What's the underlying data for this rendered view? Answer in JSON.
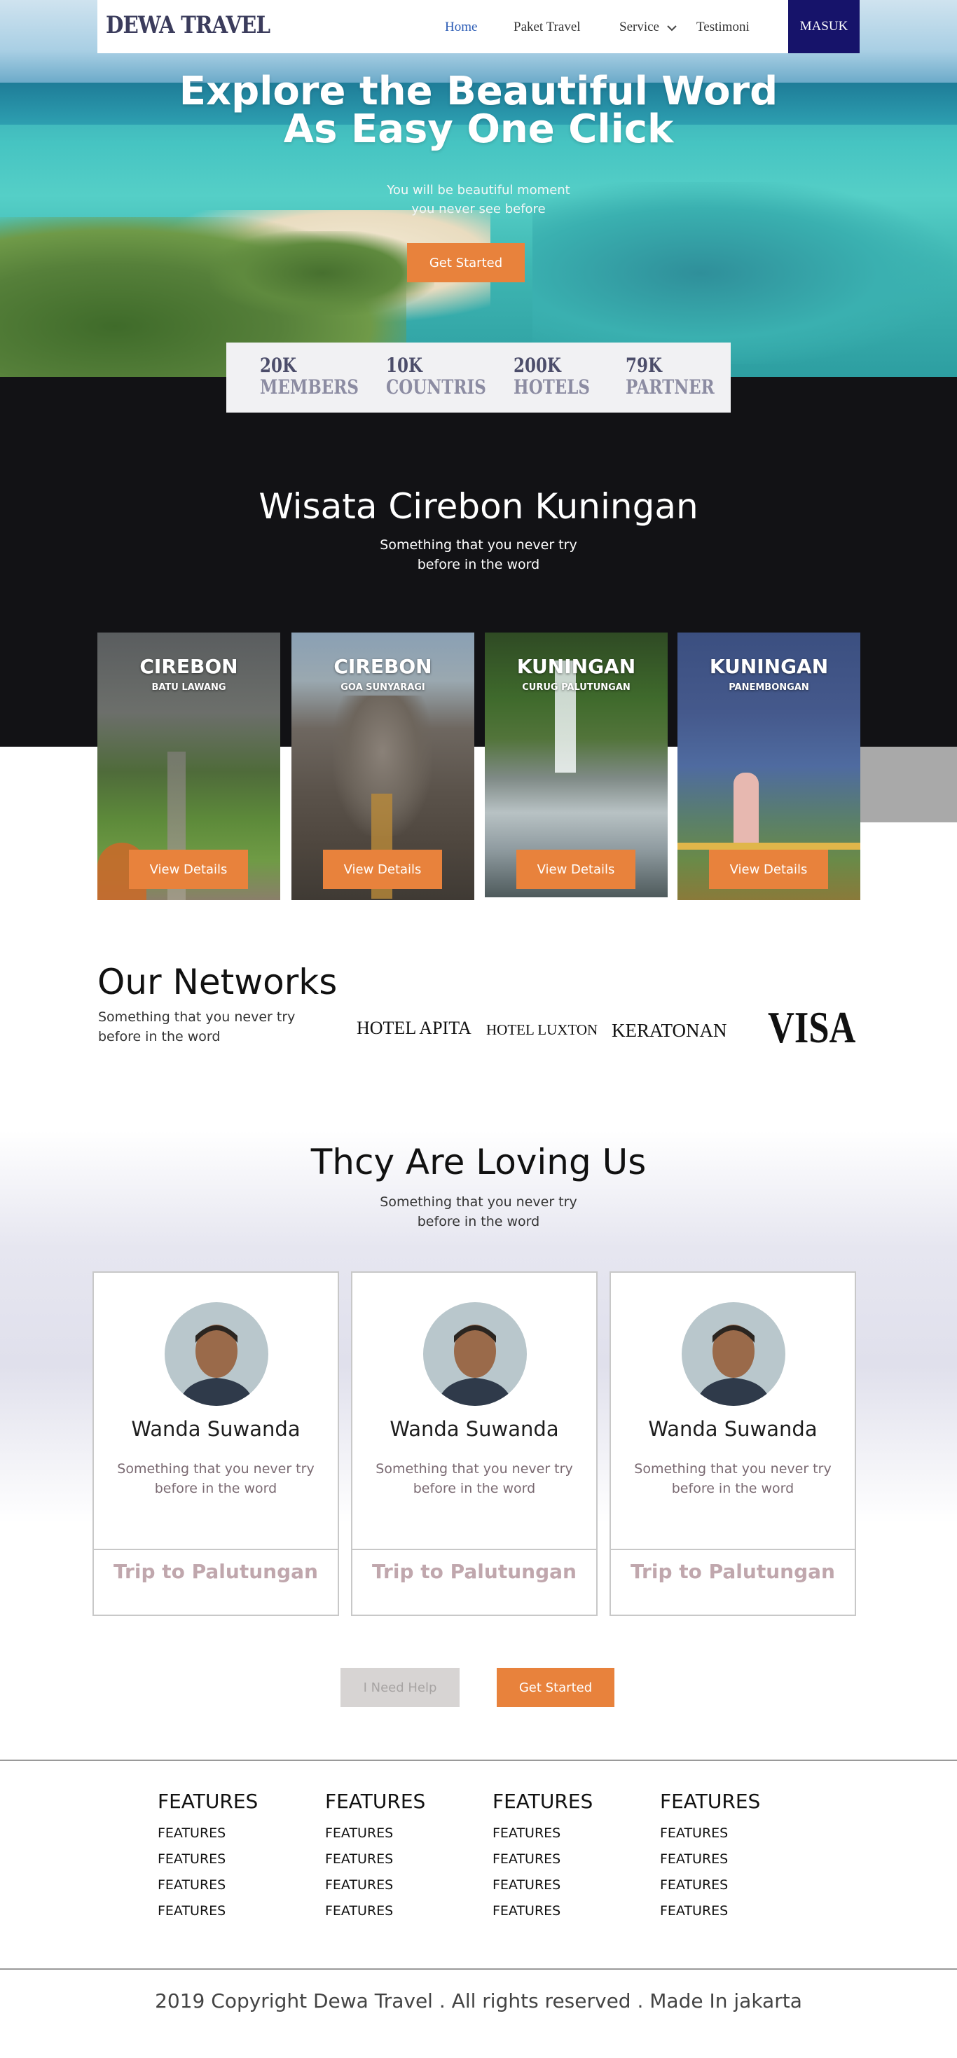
{
  "nav": {
    "logo": "DEWA TRAVEL",
    "links": [
      "Home",
      "Paket Travel",
      "Service",
      "Testimoni"
    ],
    "login": "MASUK"
  },
  "hero": {
    "title_line1": "Explore the Beautiful Word",
    "title_line2": "As Easy One Click",
    "sub_line1": "You will be beautiful moment",
    "sub_line2": "you never see before",
    "cta": "Get Started"
  },
  "stats": [
    {
      "value": "20K",
      "label": "MEMBERS"
    },
    {
      "value": "10K",
      "label": "COUNTRIS"
    },
    {
      "value": "200K",
      "label": "HOTELS"
    },
    {
      "value": "79K",
      "label": "PARTNER"
    }
  ],
  "destinations": {
    "title": "Wisata Cirebon Kuningan",
    "sub_line1": "Something that you never try",
    "sub_line2": "before in the word",
    "cards": [
      {
        "title": "CIREBON",
        "sub": "BATU LAWANG",
        "button": "View Details"
      },
      {
        "title": "CIREBON",
        "sub": "GOA SUNYARAGI",
        "button": "View Details"
      },
      {
        "title": "KUNINGAN",
        "sub": "CURUG PALUTUNGAN",
        "button": "View Details"
      },
      {
        "title": "KUNINGAN",
        "sub": "PANEMBONGAN",
        "button": "View Details"
      }
    ]
  },
  "networks": {
    "title": "Our Networks",
    "sub_line1": "Something that you never try",
    "sub_line2": "before in the word",
    "partners": [
      "HOTEL APITA",
      "HOTEL LUXTON",
      "KERATONAN",
      "VISA"
    ]
  },
  "testimonials": {
    "title": "Thcy Are Loving Us",
    "sub_line1": "Something that you never try",
    "sub_line2": "before in the word",
    "cards": [
      {
        "name": "Wanda Suwanda",
        "text_line1": "Something that you never try",
        "text_line2": "before in the word",
        "trip": "Trip to Palutungan"
      },
      {
        "name": "Wanda Suwanda",
        "text_line1": "Something that you never try",
        "text_line2": "before in the word",
        "trip": "Trip to Palutungan"
      },
      {
        "name": "Wanda Suwanda",
        "text_line1": "Something that you never try",
        "text_line2": "before in the word",
        "trip": "Trip to Palutungan"
      }
    ],
    "help_button": "I Need Help",
    "start_button": "Get Started"
  },
  "footer": {
    "columns": [
      {
        "heading": "FEATURES",
        "items": [
          "FEATURES",
          "FEATURES",
          "FEATURES",
          "FEATURES"
        ]
      },
      {
        "heading": "FEATURES",
        "items": [
          "FEATURES",
          "FEATURES",
          "FEATURES",
          "FEATURES"
        ]
      },
      {
        "heading": "FEATURES",
        "items": [
          "FEATURES",
          "FEATURES",
          "FEATURES",
          "FEATURES"
        ]
      },
      {
        "heading": "FEATURES",
        "items": [
          "FEATURES",
          "FEATURES",
          "FEATURES",
          "FEATURES"
        ]
      }
    ],
    "copyright": "2019 Copyright Dewa Travel . All rights reserved . Made In jakarta"
  },
  "colors": {
    "accent": "#e8823c",
    "nav_login_bg": "#16136a",
    "dark_section": "#121215"
  }
}
